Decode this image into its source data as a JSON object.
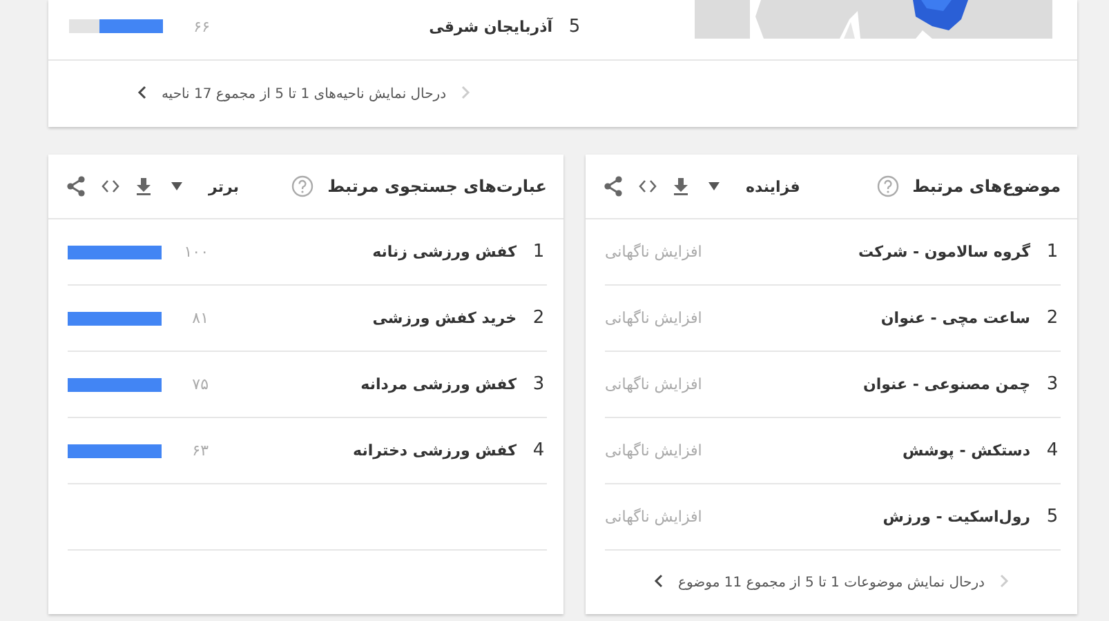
{
  "regions": {
    "rows": [
      {
        "rank": "5",
        "name": "آذربایجان شرقی",
        "value": "۶۶",
        "level": 0.68
      }
    ],
    "pagination": {
      "text": "درحال نمایش ناحیه‌های 1 تا 5 از مجموع 17 ناحیه",
      "previous_disabled": true,
      "next_disabled": false
    }
  },
  "cards": [
    {
      "title": "موضوع‌های مرتبط",
      "filter": "فزاینده",
      "kind": "breakout",
      "rows": [
        {
          "rank": "1",
          "name": "گروه سالامون - شرکت",
          "value": "افزایش ناگهانی"
        },
        {
          "rank": "2",
          "name": "ساعت مچی - عنوان",
          "value": "افزایش ناگهانی"
        },
        {
          "rank": "3",
          "name": "چمن مصنوعی - عنوان",
          "value": "افزایش ناگهانی"
        },
        {
          "rank": "4",
          "name": "دستکش - پوشش",
          "value": "افزایش ناگهانی"
        },
        {
          "rank": "5",
          "name": "رول‌اسکیت - ورزش",
          "value": "افزایش ناگهانی"
        }
      ],
      "pagination": {
        "text": "درحال نمایش موضوعات 1 تا 5 از مجموع 11 موضوع",
        "previous_disabled": true,
        "next_disabled": false
      }
    },
    {
      "title": "عبارت‌های جستجوی مرتبط",
      "filter": "برتر",
      "kind": "bars",
      "rows": [
        {
          "rank": "1",
          "name": "کفش ورزشی زنانه",
          "value": "۱۰۰",
          "level": 1
        },
        {
          "rank": "2",
          "name": "خرید کفش ورزشی",
          "value": "۸۱",
          "level": 1
        },
        {
          "rank": "3",
          "name": "کفش ورزشی مردانه",
          "value": "۷۵",
          "level": 1
        },
        {
          "rank": "4",
          "name": "کفش ورزشی دخترانه",
          "value": "۶۳",
          "level": 1
        }
      ]
    }
  ]
}
